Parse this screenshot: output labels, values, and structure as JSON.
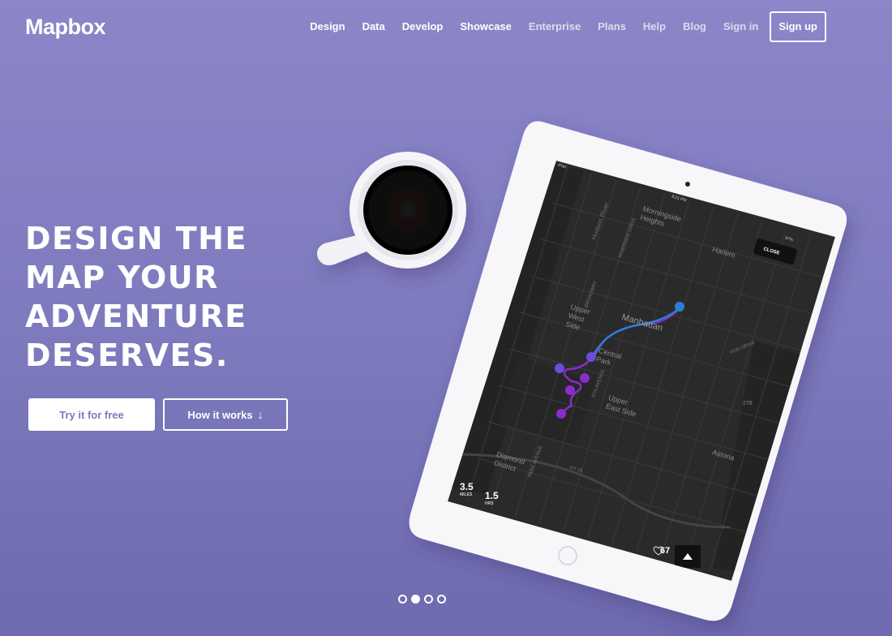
{
  "brand": {
    "logo": "Mapbox"
  },
  "nav": {
    "items": [
      {
        "label": "Design",
        "dim": false
      },
      {
        "label": "Data",
        "dim": false
      },
      {
        "label": "Develop",
        "dim": false
      },
      {
        "label": "Showcase",
        "dim": false
      },
      {
        "label": "Enterprise",
        "dim": true
      },
      {
        "label": "Plans",
        "dim": true
      },
      {
        "label": "Help",
        "dim": true
      },
      {
        "label": "Blog",
        "dim": true
      },
      {
        "label": "Sign in",
        "dim": true
      }
    ],
    "signup": "Sign up"
  },
  "hero": {
    "title_lines": [
      "DESIGN THE",
      "MAP YOUR",
      "ADVENTURE",
      "DESERVES."
    ],
    "cta_primary": "Try it for free",
    "cta_secondary": "How it works",
    "cta_secondary_icon": "arrow-down-icon"
  },
  "device": {
    "status_left": "iPad",
    "status_time": "8:21 PM",
    "status_right": "97%",
    "close_label": "CLOSE",
    "distance_value": "3.5",
    "distance_unit": "MILES",
    "duration_value": "1.5",
    "duration_unit": "HRS",
    "likes": "67",
    "map_labels": [
      "Morningside Heights",
      "Hudson River",
      "Harlem",
      "Manhattan",
      "Upper West Side",
      "Central Park",
      "Upper East Side",
      "Diamond District",
      "Astoria",
      "NY 25",
      "FDR DRIVE",
      "5TH AVENUE",
      "BROADWAY",
      "RIVERSIDE DRIVE",
      "PARK AVENUE",
      "278"
    ]
  },
  "carousel": {
    "count": 4,
    "active_index": 1
  },
  "colors": {
    "background": "#8b86c8",
    "route": "#2a7fd4",
    "pin_purple": "#8b2cc9",
    "map_bg": "#2a2a2a"
  }
}
